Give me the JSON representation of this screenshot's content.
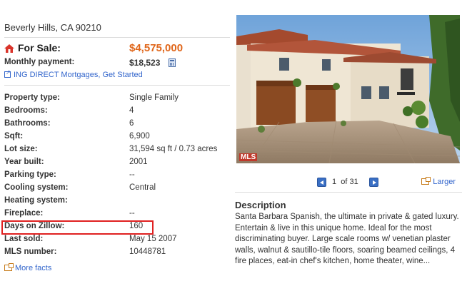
{
  "listing": {
    "address": "Beverly Hills, CA 90210",
    "sale_label": "For Sale:",
    "price": "$4,575,000",
    "monthly_label": "Monthly payment:",
    "monthly_value": "$18,523",
    "mortgage_link": "ING DIRECT Mortgages, Get Started"
  },
  "facts": [
    {
      "key": "Property type:",
      "value": "Single Family"
    },
    {
      "key": "Bedrooms:",
      "value": "4"
    },
    {
      "key": "Bathrooms:",
      "value": "6"
    },
    {
      "key": "Sqft:",
      "value": "6,900"
    },
    {
      "key": "Lot size:",
      "value": "31,594 sq ft / 0.73 acres"
    },
    {
      "key": "Year built:",
      "value": "2001"
    },
    {
      "key": "Parking type:",
      "value": "--"
    },
    {
      "key": "Cooling system:",
      "value": "Central"
    },
    {
      "key": "Heating system:",
      "value": ""
    },
    {
      "key": "Fireplace:",
      "value": "--"
    },
    {
      "key": "Days on Zillow:",
      "value": "160"
    },
    {
      "key": "Last sold:",
      "value": "May 15 2007"
    },
    {
      "key": "MLS number:",
      "value": "10448781"
    }
  ],
  "more_facts": "More facts",
  "gallery": {
    "badge": "MLS",
    "current": "1",
    "of": "of",
    "total": "31",
    "larger": "Larger"
  },
  "description": {
    "title": "Description",
    "text": "Santa Barbara Spanish, the ultimate in private & gated luxury. Entertain & live in this unique home. Ideal for the most discriminating buyer. Large scale rooms w/ venetian plaster walls, walnut & sautillo-tile floors, soaring beamed ceilings, 4 fire places, eat-in chef's kitchen, home theater, wine..."
  },
  "colors": {
    "price": "#e0661a",
    "link": "#3366cc",
    "highlight": "#e02020"
  }
}
